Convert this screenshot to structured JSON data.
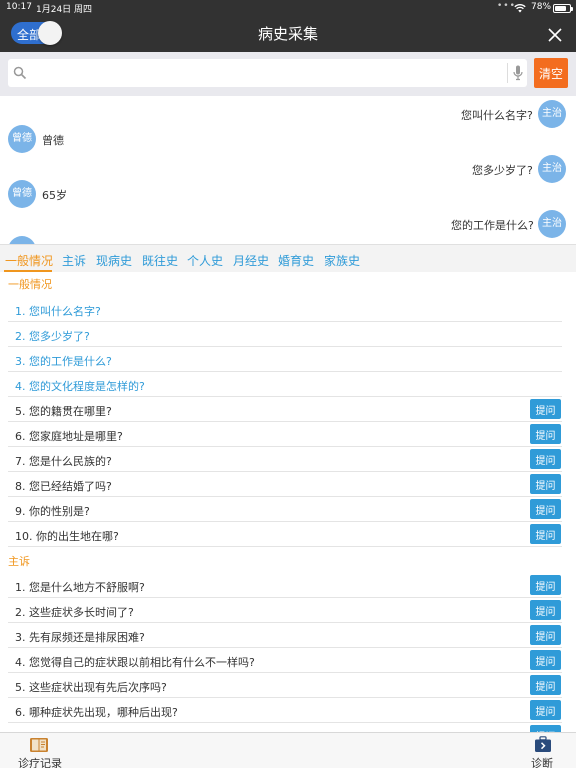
{
  "status_bar": {
    "time": "10:17",
    "date": "1月24日 周四",
    "battery_percent": "78%",
    "battery_level": 0.78
  },
  "header": {
    "toggle_label": "全部",
    "title": "病史采集",
    "close_icon": "close-icon"
  },
  "search": {
    "placeholder": "",
    "value": "",
    "clear_label": "清空"
  },
  "chat": {
    "doctor_avatar": "主治",
    "patient_avatar": "曾德",
    "messages": [
      {
        "from": "doctor",
        "text": "您叫什么名字?"
      },
      {
        "from": "patient",
        "text": "曾德"
      },
      {
        "from": "doctor",
        "text": "您多少岁了?"
      },
      {
        "from": "patient",
        "text": "65岁"
      },
      {
        "from": "doctor",
        "text": "您的工作是什么?"
      }
    ]
  },
  "tabs": [
    "一般情况",
    "主诉",
    "现病史",
    "既往史",
    "个人史",
    "月经史",
    "婚育史",
    "家族史"
  ],
  "ask_label": "提问",
  "sections": [
    {
      "title": "一般情况",
      "questions": [
        {
          "text": "1. 您叫什么名字?",
          "asked": true
        },
        {
          "text": "2. 您多少岁了?",
          "asked": true
        },
        {
          "text": "3. 您的工作是什么?",
          "asked": true
        },
        {
          "text": "4. 您的文化程度是怎样的?",
          "asked": true
        },
        {
          "text": "5. 您的籍贯在哪里?",
          "asked": false
        },
        {
          "text": "6. 您家庭地址是哪里?",
          "asked": false
        },
        {
          "text": "7. 您是什么民族的?",
          "asked": false
        },
        {
          "text": "8. 您已经结婚了吗?",
          "asked": false
        },
        {
          "text": "9. 你的性别是?",
          "asked": false
        },
        {
          "text": "10. 你的出生地在哪?",
          "asked": false
        }
      ]
    },
    {
      "title": "主诉",
      "questions": [
        {
          "text": "1. 您是什么地方不舒服啊?",
          "asked": false
        },
        {
          "text": "2. 这些症状多长时间了?",
          "asked": false
        },
        {
          "text": "3. 先有尿频还是排尿困难?",
          "asked": false
        },
        {
          "text": "4. 您觉得自己的症状跟以前相比有什么不一样吗?",
          "asked": false
        },
        {
          "text": "5. 这些症状出现有先后次序吗?",
          "asked": false
        },
        {
          "text": "6. 哪种症状先出现，哪种后出现?",
          "asked": false
        }
      ]
    }
  ],
  "bottom_bar": {
    "left_label": "诊疗记录",
    "right_label": "诊断"
  },
  "colors": {
    "header_bg": "#323232",
    "accent_blue": "#2f9bd8",
    "accent_orange": "#f0961e",
    "clear_button": "#f36d1f",
    "avatar_blue": "#7bb4e8"
  }
}
